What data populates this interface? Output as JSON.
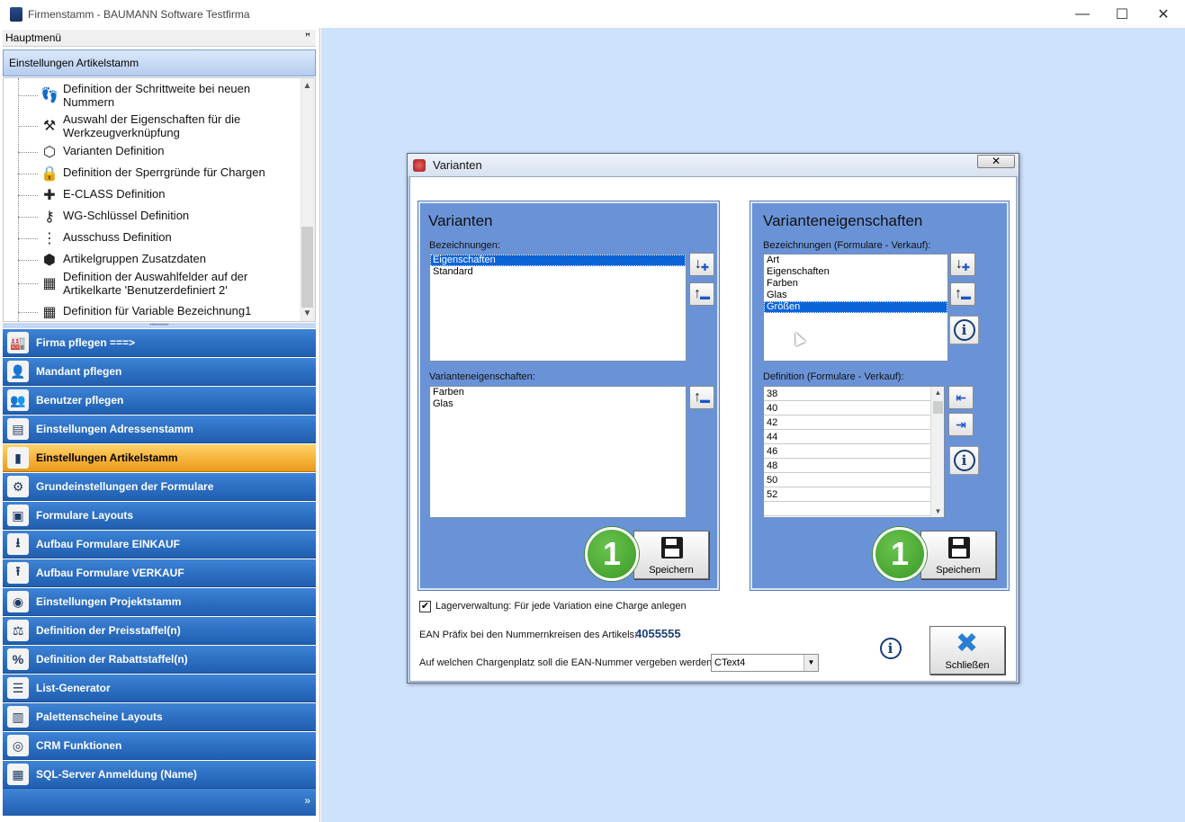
{
  "window": {
    "title": "Firmenstamm - BAUMANN Software Testfirma",
    "minimize": "—",
    "maximize": "☐",
    "close": "✕"
  },
  "left": {
    "header": "Hauptmenü",
    "pin": "ꟸ",
    "section": "Einstellungen Artikelstamm",
    "splitter": "••••••••••",
    "tree": [
      {
        "icon": "footprints",
        "glyph": "👣",
        "line1": "Definition der Schrittweite bei neuen",
        "line2": "Nummern"
      },
      {
        "icon": "tools",
        "glyph": "⚒",
        "line1": "Auswahl der Eigenschaften für die",
        "line2": "Werkzeugverknüpfung"
      },
      {
        "icon": "box",
        "glyph": "⬡",
        "line1": "Varianten Definition",
        "line2": ""
      },
      {
        "icon": "lock",
        "glyph": "🔒",
        "line1": "Definition der Sperrgründe für Chargen",
        "line2": ""
      },
      {
        "icon": "puzzle",
        "glyph": "✚",
        "line1": "E-CLASS Definition",
        "line2": ""
      },
      {
        "icon": "key",
        "glyph": "⚷",
        "line1": "WG-Schlüssel Definition",
        "line2": ""
      },
      {
        "icon": "traffic-light",
        "glyph": "⋮",
        "line1": "Ausschuss Definition",
        "line2": ""
      },
      {
        "icon": "cube",
        "glyph": "⬢",
        "line1": "Artikelgruppen Zusatzdaten",
        "line2": ""
      },
      {
        "icon": "form",
        "glyph": "▦",
        "line1": "Definition der Auswahlfelder auf der",
        "line2": "Artikelkarte 'Benutzerdefiniert 2'"
      },
      {
        "icon": "calendar",
        "glyph": "▦",
        "line1": "Definition für Variable Bezeichnung1",
        "line2": ""
      }
    ],
    "nav": [
      {
        "icon": "factory",
        "glyph": "🏭",
        "label": "Firma pflegen   ===>",
        "active": false
      },
      {
        "icon": "client",
        "glyph": "👤",
        "label": "Mandant pflegen",
        "active": false
      },
      {
        "icon": "users",
        "glyph": "👥",
        "label": "Benutzer pflegen",
        "active": false
      },
      {
        "icon": "address-card",
        "glyph": "▤",
        "label": "Einstellungen Adressenstamm",
        "active": false
      },
      {
        "icon": "barcode-scanner",
        "glyph": "▮",
        "label": "Einstellungen Artikelstamm",
        "active": true
      },
      {
        "icon": "gear-doc",
        "glyph": "⚙",
        "label": "Grundeinstellungen der Formulare",
        "active": false
      },
      {
        "icon": "layout",
        "glyph": "▣",
        "label": "Formulare Layouts",
        "active": false
      },
      {
        "icon": "download-tray",
        "glyph": "⭳",
        "label": "Aufbau Formulare EINKAUF",
        "active": false
      },
      {
        "icon": "upload-tray",
        "glyph": "⭱",
        "label": "Aufbau Formulare VERKAUF",
        "active": false
      },
      {
        "icon": "project",
        "glyph": "◉",
        "label": "Einstellungen Projektstamm",
        "active": false
      },
      {
        "icon": "price-scale",
        "glyph": "⚖",
        "label": "Definition der Preisstaffel(n)",
        "active": false
      },
      {
        "icon": "percent",
        "glyph": "%",
        "label": "Definition der Rabattstaffel(n)",
        "active": false
      },
      {
        "icon": "list",
        "glyph": "☰",
        "label": "List-Generator",
        "active": false
      },
      {
        "icon": "pallet",
        "glyph": "▥",
        "label": "Palettenscheine Layouts",
        "active": false
      },
      {
        "icon": "crm",
        "glyph": "◎",
        "label": "CRM Funktionen",
        "active": false
      },
      {
        "icon": "database",
        "glyph": "▦",
        "label": "SQL-Server Anmeldung (Name)",
        "active": false
      }
    ],
    "footer_chevron": "»"
  },
  "dialog": {
    "title": "Varianten",
    "close": "✕",
    "varianten": {
      "heading": "Varianten",
      "bez_label": "Bezeichnungen:",
      "bez_items": [
        "Eigenschaften",
        "Standard"
      ],
      "bez_selected": 0,
      "ve_label": "Varianteneigenschaften:",
      "ve_items": [
        "Farben",
        "Glas"
      ],
      "save": "Speichern",
      "badge": "1"
    },
    "variantenprops": {
      "heading": "Varianteneigenschaften",
      "bez_label": "Bezeichnungen (Formulare - Verkauf):",
      "bez_items": [
        "Art",
        "Eigenschaften",
        "Farben",
        "Glas",
        "Größen"
      ],
      "bez_selected": 4,
      "def_label": "Definition (Formulare - Verkauf):",
      "def_items": [
        "38",
        "40",
        "42",
        "44",
        "46",
        "48",
        "50",
        "52",
        ""
      ],
      "save": "Speichern",
      "badge": "1"
    },
    "lager_checked": true,
    "lager_label": "Lagerverwaltung: Für jede Variation eine Charge anlegen",
    "ean_label": "EAN Präfix bei den Nummernkreisen des Artikels:",
    "ean_value": "4055555",
    "charge_label": "Auf welchen Chargenplatz soll die EAN-Nummer vergeben werden:",
    "charge_value": "CText4",
    "close_button": "Schließen",
    "info": "i"
  }
}
